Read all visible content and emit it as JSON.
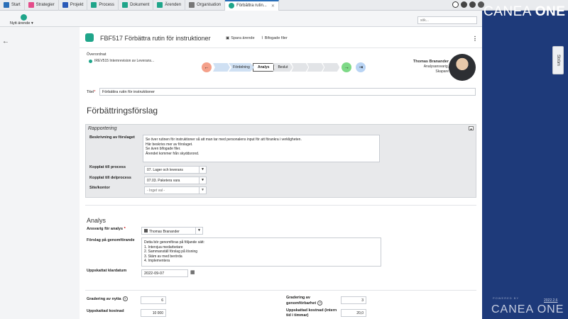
{
  "tabs": [
    {
      "label": "Start",
      "color": "#2a6fb8",
      "icon": "home-icon"
    },
    {
      "label": "Strategier",
      "color": "#e44c8a",
      "icon": "strategies-icon"
    },
    {
      "label": "Projekt",
      "color": "#2a5ab8",
      "icon": "project-icon"
    },
    {
      "label": "Process",
      "color": "#1fa58a",
      "icon": "process-icon"
    },
    {
      "label": "Dokument",
      "color": "#1fa58a",
      "icon": "document-icon"
    },
    {
      "label": "Ärenden",
      "color": "#1fa58a",
      "icon": "cases-icon"
    },
    {
      "label": "Organisation",
      "color": "#555555",
      "icon": "organisation-icon"
    },
    {
      "label": "Förbättra rutin...",
      "color": "#1fa58a",
      "icon": "case-icon",
      "active": true
    }
  ],
  "toolbar": {
    "new_case": "Nytt ärende",
    "search_placeholder": "sök..."
  },
  "brand": {
    "name_light": "CANEA ",
    "name_bold": "ONE",
    "powered_by": "POWERED BY",
    "footer": "CANEA ONE",
    "version": "2022.2.6"
  },
  "side_tab": "Ström",
  "case": {
    "title": "FBF517 Förbättra rutin för instruktioner",
    "save_label": "Spara ärende",
    "attachments_label": "Bifogade filer",
    "parent_label": "Överordnat",
    "parent_value": "IREV515 Internrevision av Leverans...",
    "title_label": "Titel",
    "title_value": "Förbättra rutin för instruktioner"
  },
  "workflow": {
    "steps": [
      {
        "label": "Fördelning",
        "state": "done"
      },
      {
        "label": "Analys",
        "state": "current"
      },
      {
        "label": "Beslut",
        "state": "upcoming"
      },
      {
        "label": "",
        "state": "upcoming"
      },
      {
        "label": "",
        "state": "upcoming"
      },
      {
        "label": "",
        "state": "upcoming"
      }
    ]
  },
  "person": {
    "name": "Thomas Branander",
    "role1": "Analysansvarig,",
    "role2": "Skapare"
  },
  "improvement": {
    "section_title": "Förbättringsförslag",
    "panel_title": "Rapportering",
    "description_label": "Beskrivning av förslaget",
    "description_lines": [
      "Se över rutinen för instruktioner så att man tar med personalens input för att förankra i verkligheten.",
      "Här beskrivs mer av förslaget.",
      "Se även bifogade filer.",
      "Ärendet kommer från skyddsrond."
    ],
    "process_label": "Kopplat till process",
    "process_value": "07. Lager och leverans",
    "subprocess_label": "Kopplat till delprocess",
    "subprocess_value": "07.03. Paketera vara",
    "site_label": "Site/kontor",
    "site_value": "- Inget val -"
  },
  "analysis": {
    "section_title": "Analys",
    "responsible_label": "Ansvarig för analys",
    "responsible_value": "Thomas Branander",
    "proposal_label": "Förslag på genomförande",
    "proposal_lines": [
      "Detta bör genomföras på följande sätt:",
      "1. Intervjua medarbetare",
      "2. Sammanställ förslag på lösning",
      "3. Stäm av med berörda",
      "4. Implementera"
    ],
    "ready_date_label": "Uppskattat klardatum",
    "ready_date_value": "2022-09-07",
    "benefit_label": "Gradering av nytta",
    "benefit_value": "6",
    "feasibility_label": "Gradering av genomförbarhet",
    "feasibility_value": "3",
    "cost_label": "Uppskattad kostnad",
    "cost_value": "10 000",
    "time_label": "Uppskattad kostnad (intern tid i timmar)",
    "time_value": "20,0"
  }
}
